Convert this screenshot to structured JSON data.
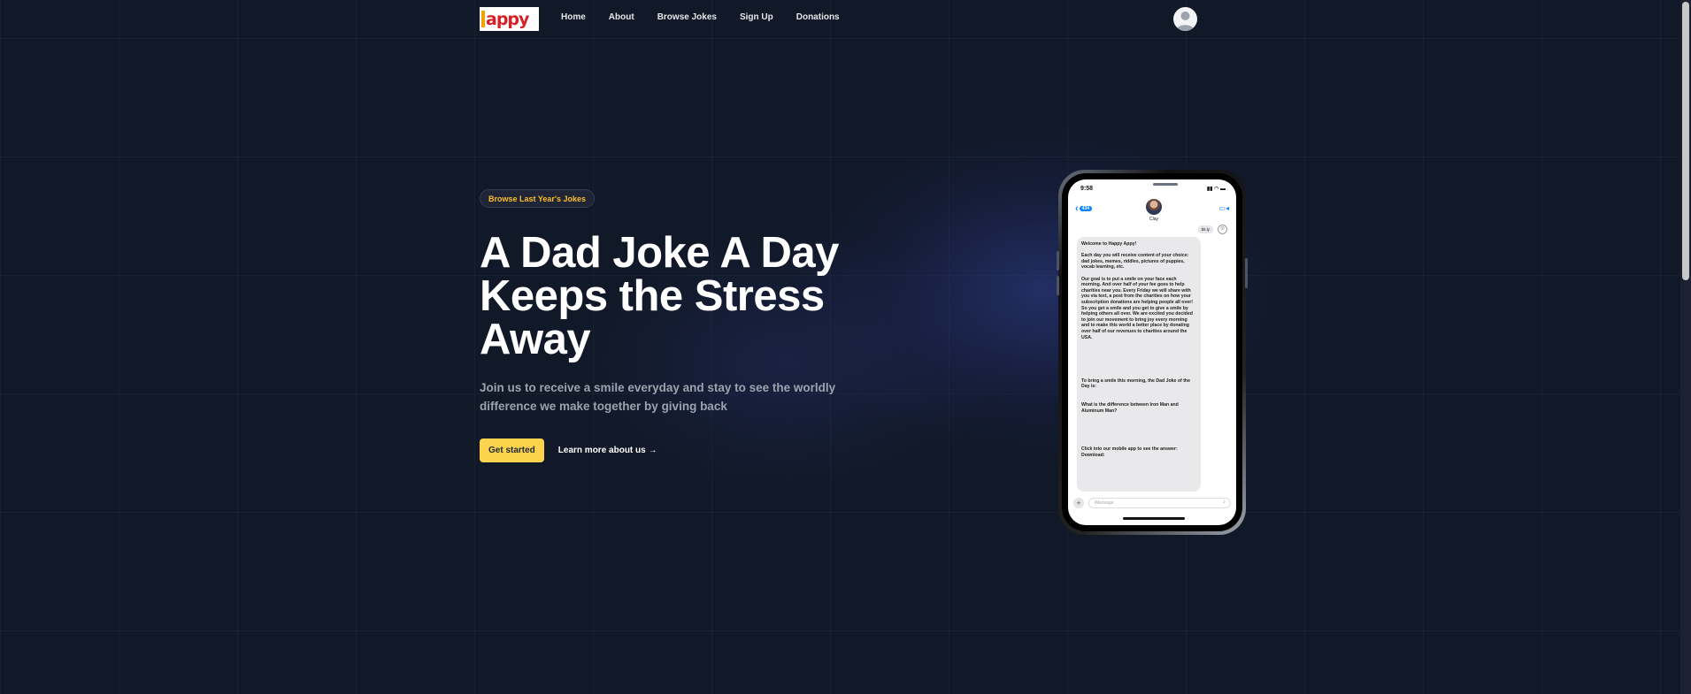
{
  "nav": {
    "logo_text": "appy",
    "links": [
      "Home",
      "About",
      "Browse Jokes",
      "Sign Up",
      "Donations"
    ]
  },
  "hero": {
    "pill_label": "Browse Last Year's Jokes",
    "headline": "A Dad Joke A Day Keeps the Stress Away",
    "subtext": "Join us to receive a smile everyday and stay to see the worldly difference we make together by giving back",
    "primary_button": "Get started",
    "secondary_link": "Learn more about us →"
  },
  "phone": {
    "status_time": "9:58",
    "status_icons": "▮▮ ◠ ▬",
    "back_badge": "434",
    "contact_name": "Clay",
    "top_bubble": "bit.ly",
    "message_paragraphs": [
      "Welcome to Happy Appy!",
      "Each day you will receive content of your choice: dad jokes, memes, riddles, pictures of puppies, vocab learning, etc.",
      "Our goal is to put a smile on your face each morning. And over half of your fee goes to help charities near you. Every Friday we will share with you via text, a post from the charities on how your subscription donations are helping people all over! So you get a smile and you get to give a smile by helping others all over. We are excited you decided to join our movement to bring joy every morning and to make this world a better place by donating over half of our revenues to charities around the USA.",
      "To bring a smile this morning, the Dad Joke of the Day is:",
      "What is the difference between Iron Man and Aluminum Man?",
      "Click into our mobile app to see the answer: Download:"
    ],
    "compose_placeholder": "iMessage"
  },
  "colors": {
    "background": "#111827",
    "accent": "#fcd34d",
    "pill_text": "#fbbf24",
    "logo_red": "#d61f26",
    "logo_orange": "#f4a300"
  }
}
